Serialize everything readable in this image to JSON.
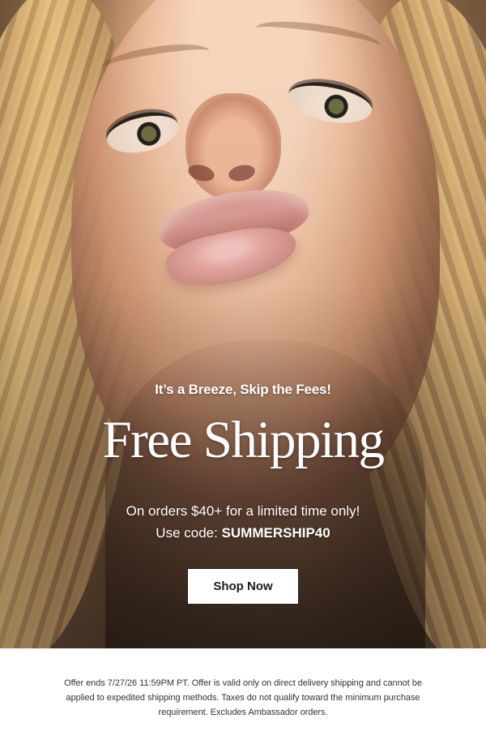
{
  "hero": {
    "eyebrow": "It’s a Breeze, Skip the Fees!",
    "headline": "Free Shipping",
    "offer_line": "On orders $40+ for a limited time only!",
    "code_prefix": "Use code: ",
    "code": "SUMMERSHIP40",
    "button_label": "Shop Now"
  },
  "footer": {
    "legal_text": "Offer ends 7/27/26 11:59PM PT. Offer is valid only on direct delivery shipping and cannot be applied to expedited shipping methods. Taxes do not qualify toward the minimum purchase requirement. Excludes Ambassador orders."
  },
  "colors": {
    "text_light": "#ffffff",
    "button_background": "#ffffff",
    "button_border": "#222222",
    "footer_text": "#333333"
  },
  "icons": []
}
